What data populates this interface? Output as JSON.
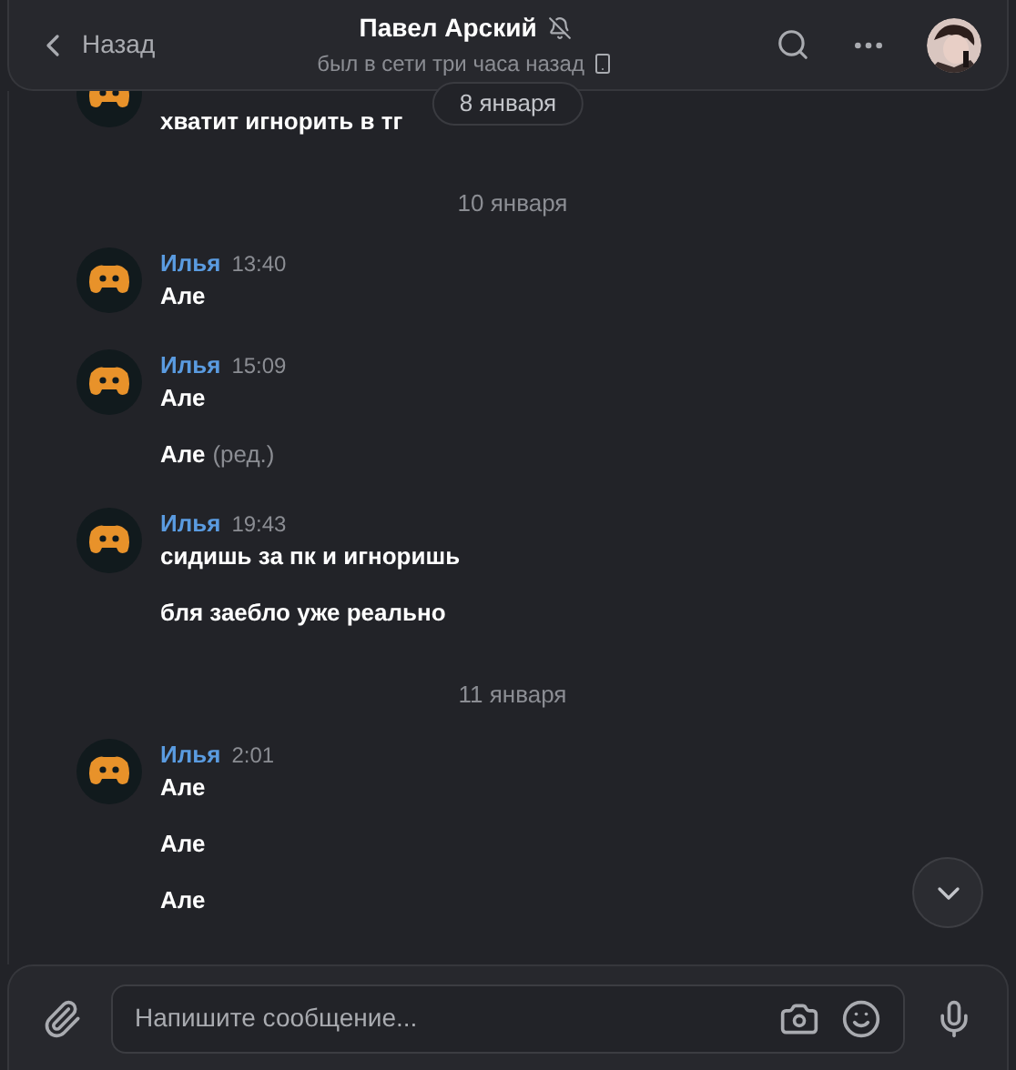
{
  "header": {
    "back_label": "Назад",
    "title": "Павел Арский",
    "muted": true,
    "status": "был в сети три часа назад",
    "mobile": true
  },
  "floating_date": "8 января",
  "feed": [
    {
      "kind": "group",
      "messages": [
        {
          "text": "хватит игнорить в тг"
        }
      ]
    },
    {
      "kind": "date",
      "text": "10 января"
    },
    {
      "kind": "group",
      "author": "Илья",
      "time": "13:40",
      "messages": [
        {
          "text": "Але"
        }
      ]
    },
    {
      "kind": "group",
      "author": "Илья",
      "time": "15:09",
      "messages": [
        {
          "text": "Але"
        },
        {
          "text": "Але",
          "edited_label": "(ред.)"
        }
      ]
    },
    {
      "kind": "group",
      "author": "Илья",
      "time": "19:43",
      "messages": [
        {
          "text": "сидишь за пк и игноришь"
        },
        {
          "text": "бля заебло уже реально"
        }
      ]
    },
    {
      "kind": "date",
      "text": "11 января"
    },
    {
      "kind": "group",
      "author": "Илья",
      "time": "2:01",
      "messages": [
        {
          "text": "Але"
        },
        {
          "text": "Але"
        },
        {
          "text": "Але"
        }
      ]
    }
  ],
  "composer": {
    "placeholder": "Напишите сообщение..."
  }
}
